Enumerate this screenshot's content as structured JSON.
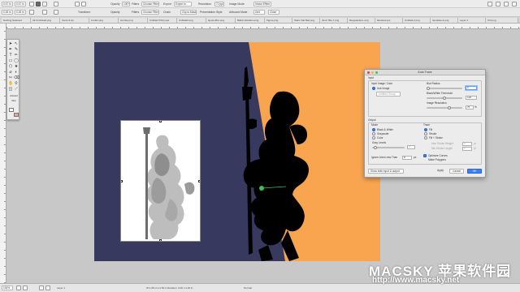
{
  "toolbar1": {
    "items": [
      "Opacity",
      "Filters",
      "Choose Filter",
      "Export",
      "Export to...",
      "Resolution",
      "Image Mode",
      "Vector Effect"
    ],
    "fields": [
      "0.47 in",
      "0.47 in",
      "100%",
      "Normal",
      "72 ppi"
    ]
  },
  "toolbar2": {
    "items": [
      "Transform",
      "Opacity",
      "Filters",
      "Choose Filter",
      "Chain",
      "Clip to Mask",
      "Presentation Style",
      "Artboard Mode",
      "Grid",
      "Close"
    ],
    "fields": [
      "0.26 in",
      "0.26 in"
    ]
  },
  "tabs": [
    "Nothing Selected",
    "All Unclicked.png",
    "Vecto-3.zip",
    "Linda1.png",
    "sunrise.png",
    "Untitled Prinfy.eps",
    "Untitled2.png",
    "layout-Box.png",
    "Ballon-Rotation.png",
    "Figure.png",
    "Stars Cali Bed.png",
    "Alt & Title-7.png",
    "Rayquacker+.png",
    "blended.eps",
    "Untitled-2.png",
    "template-A.png",
    "Layer 2",
    "Ctrl.png"
  ],
  "tools": {
    "label_a": "Artboard",
    "label_b": "Slice"
  },
  "dialog": {
    "title": "Auto Trace",
    "input": {
      "section": "Input",
      "input_image_label": "Input Image: Color",
      "use_image": "Use Image",
      "use_image_popup": "Untitled Group",
      "blur_radius_label": "Blur Radius",
      "blur_radius_value": "0",
      "bw_threshold_label": "Black/White Threshold",
      "bw_threshold_value": "128",
      "image_resolution_label": "Image Resolution",
      "image_resolution_value": "75"
    },
    "output": {
      "section": "Output",
      "mode_label": "Mode",
      "mode_bw": "Black & White",
      "mode_gray": "Grayscale",
      "mode_color": "Color",
      "gray_levels_label": "Gray Levels",
      "gray_levels_value": "4",
      "trace_label": "Trace",
      "trace_fill": "Fill",
      "trace_stroke": "Stroke",
      "trace_fill_stroke": "Fill + Stroke",
      "max_stroke_label": "Max Stroke Weight",
      "max_stroke_value": "0",
      "max_stroke_unit": "pt",
      "min_stroke_label": "Min Stroke Length",
      "min_stroke_value": "0",
      "min_stroke_unit": "pt",
      "ignore_label": "Ignore Area Less Than",
      "ignore_value": "8",
      "ignore_unit": "px",
      "optimize_curves": "Optimize Curves",
      "make_polygons": "Make Polygons"
    },
    "show_popup": "Show both input & output",
    "apply": "Apply",
    "cancel": "Cancel",
    "ok": "OK"
  },
  "status": {
    "zoom": "100%",
    "page": "Layer 1",
    "coords": "W:1.08 in  H:1.50 in  Rotation: 0.00  L:3.20 in",
    "mode": "Normal"
  },
  "watermark": {
    "line1": "MACSKY 苹果软件园",
    "line2": "http://www.macsky.net"
  },
  "colors": {
    "navy": "#373a5e",
    "orange": "#f9a550",
    "silhouette": "#000000",
    "accent": "#3b7ff5"
  }
}
